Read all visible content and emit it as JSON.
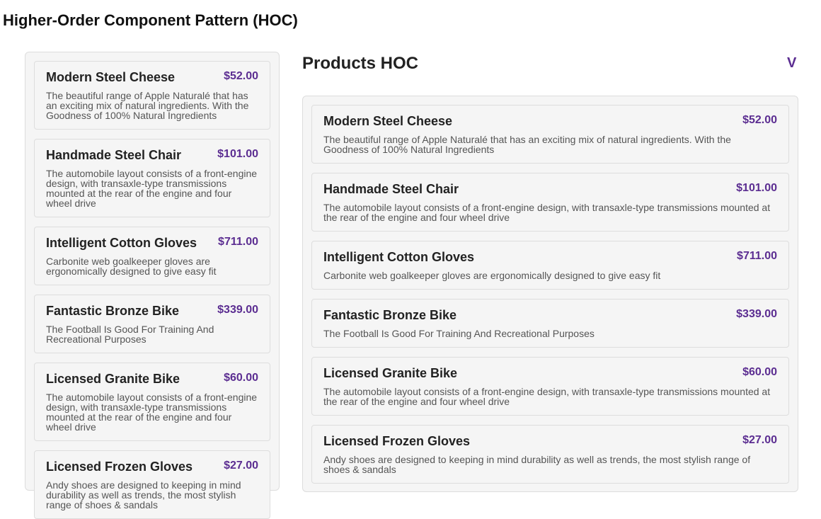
{
  "page_title": "Higher-Order Component Pattern (HOC)",
  "right": {
    "title": "Products HOC",
    "toggle_label": "V"
  },
  "colors": {
    "price": "#5b2d91"
  },
  "products": [
    {
      "name": "Modern Steel Cheese",
      "price": "$52.00",
      "description": "The beautiful range of Apple Naturalé that has an exciting mix of natural ingredients. With the Goodness of 100% Natural Ingredients"
    },
    {
      "name": "Handmade Steel Chair",
      "price": "$101.00",
      "description": "The automobile layout consists of a front-engine design, with transaxle-type transmissions mounted at the rear of the engine and four wheel drive"
    },
    {
      "name": "Intelligent Cotton Gloves",
      "price": "$711.00",
      "description": "Carbonite web goalkeeper gloves are ergonomically designed to give easy fit"
    },
    {
      "name": "Fantastic Bronze Bike",
      "price": "$339.00",
      "description": "The Football Is Good For Training And Recreational Purposes"
    },
    {
      "name": "Licensed Granite Bike",
      "price": "$60.00",
      "description": "The automobile layout consists of a front-engine design, with transaxle-type transmissions mounted at the rear of the engine and four wheel drive"
    },
    {
      "name": "Licensed Frozen Gloves",
      "price": "$27.00",
      "description": "Andy shoes are designed to keeping in mind durability as well as trends, the most stylish range of shoes & sandals"
    }
  ]
}
